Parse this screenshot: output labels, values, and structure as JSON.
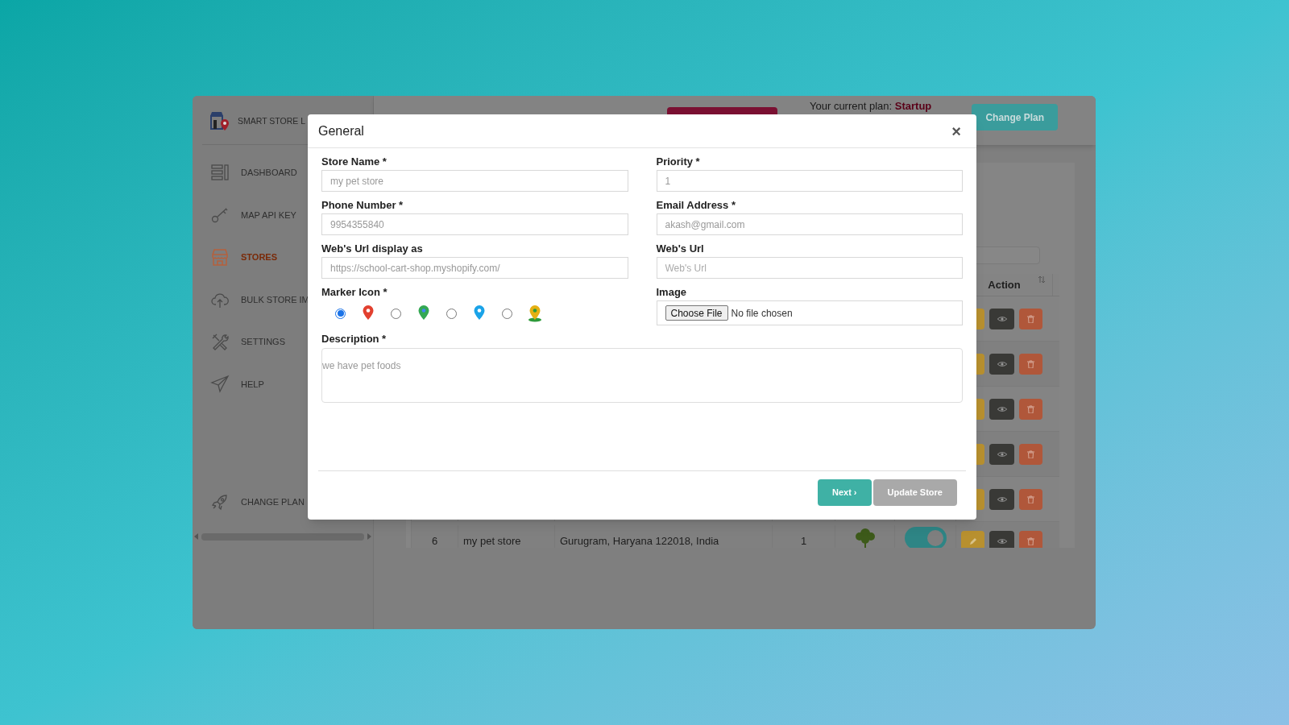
{
  "sidebar": {
    "brand": "SMART STORE L",
    "items": [
      {
        "label": "DASHBOARD",
        "selected": false
      },
      {
        "label": "MAP API KEY",
        "selected": false
      },
      {
        "label": "STORES",
        "selected": true
      },
      {
        "label": "BULK STORE IM",
        "selected": false
      },
      {
        "label": "SETTINGS",
        "selected": false
      },
      {
        "label": "HELP",
        "selected": false
      }
    ],
    "footer_item": {
      "label": "CHANGE PLAN",
      "selected": false
    }
  },
  "topbar": {
    "plan_label": "Your current plan:",
    "plan_name": "Startup",
    "button": "Change Plan"
  },
  "table": {
    "columns": [
      "Action"
    ],
    "rows": [
      {
        "cells": [
          "6",
          "my pet store",
          "Gurugram, Haryana 122018, India",
          "1"
        ],
        "enabled": true
      }
    ]
  },
  "modal": {
    "title": "General",
    "close": "×",
    "fields": [
      {
        "kind": "text",
        "label": "Store Name *",
        "value": "my pet store"
      },
      {
        "kind": "text",
        "label": "Priority *",
        "value": "1"
      },
      {
        "kind": "text",
        "label": "Phone Number *",
        "value": "9954355840"
      },
      {
        "kind": "text",
        "label": "Email Address *",
        "value": "akash@gmail.com"
      },
      {
        "kind": "text",
        "label": "Web's Url display as",
        "value": "https://school-cart-shop.myshopify.com/"
      },
      {
        "kind": "text",
        "label": "Web's Url",
        "placeholder": "Web's Url"
      },
      {
        "kind": "radios",
        "label": "Marker Icon *",
        "options": [
          {
            "selected": true
          },
          {
            "selected": false
          },
          {
            "selected": false
          },
          {
            "selected": false
          }
        ]
      },
      {
        "kind": "file",
        "label": "Image",
        "button": "Choose File",
        "status": "No file chosen"
      },
      {
        "kind": "textarea",
        "label": "Description *",
        "value": "we have pet foods"
      }
    ],
    "buttons": [
      {
        "label": "Next ›",
        "disabled": false
      },
      {
        "label": "Update Store",
        "disabled": true
      }
    ]
  }
}
